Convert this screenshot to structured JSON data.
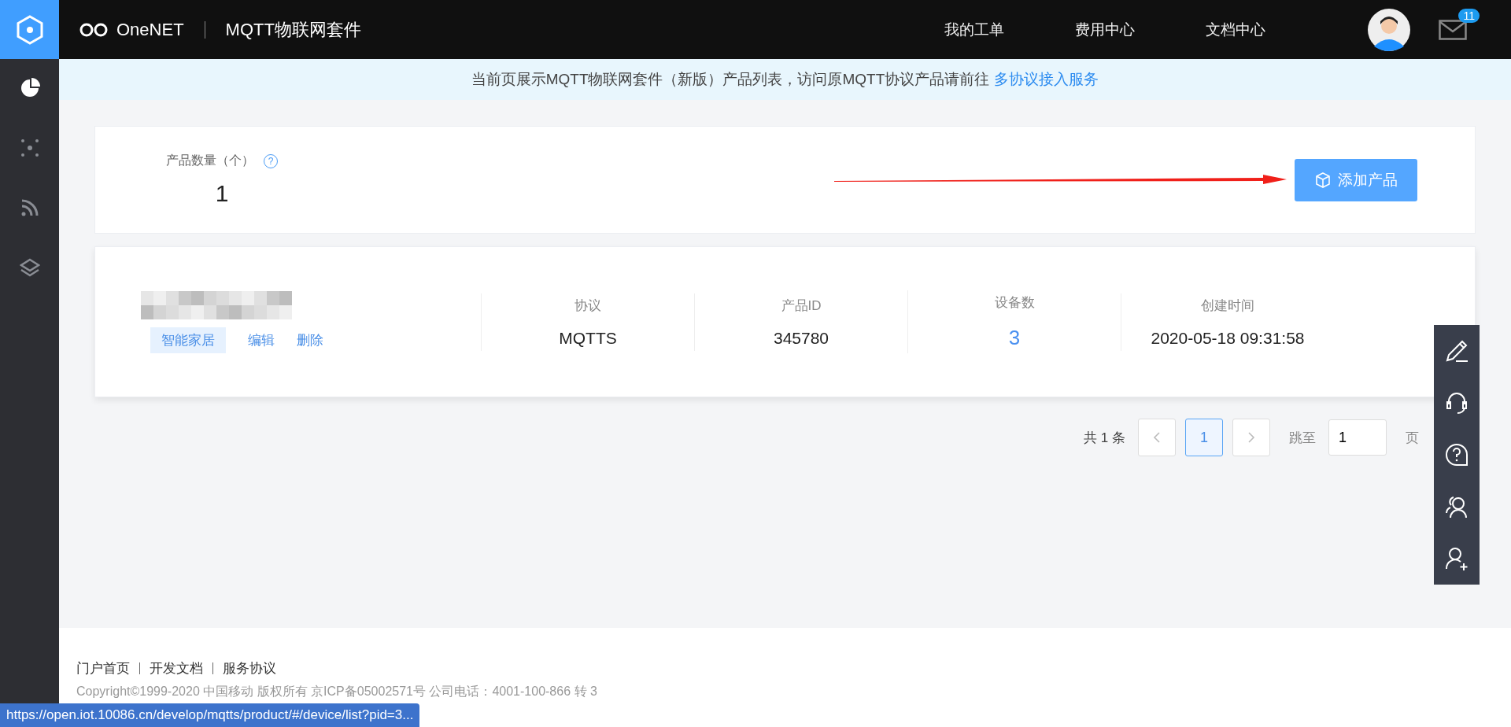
{
  "header": {
    "brand": "OneNET",
    "product": "MQTT物联网套件",
    "nav": [
      "我的工单",
      "费用中心",
      "文档中心"
    ],
    "badge": "11"
  },
  "sidebar": {
    "items": [
      {
        "selected": true
      },
      {
        "selected": false
      },
      {
        "selected": false
      },
      {
        "selected": false
      }
    ]
  },
  "notice": {
    "text": "当前页展示MQTT物联网套件（新版）产品列表，访问原MQTT协议产品请前往",
    "link": "多协议接入服务"
  },
  "summary": {
    "label": "产品数量（个）",
    "help": "?",
    "count": "1",
    "add_button": "添加产品"
  },
  "products": [
    {
      "tag": "智能家居",
      "actions": [
        "编辑",
        "删除"
      ],
      "fields": [
        {
          "label": "协议",
          "value": "MQTTS",
          "kind": "text"
        },
        {
          "label": "产品ID",
          "value": "345780",
          "kind": "text"
        },
        {
          "label": "设备数",
          "value": "3",
          "kind": "link"
        },
        {
          "label": "创建时间",
          "value": "2020-05-18 09:31:58",
          "kind": "text"
        }
      ]
    }
  ],
  "pagination": {
    "total": "共 1 条",
    "pages": [
      {
        "label": "1",
        "selected": true
      }
    ],
    "jump_label": "跳至",
    "jump_value": "1",
    "page_suffix": "页"
  },
  "footer": {
    "links": [
      "门户首页",
      "开发文档",
      "服务协议"
    ],
    "copyright": "Copyright©1999-2020 中国移动 版权所有 京ICP备05002571号 公司电话：4001-100-866 转 3"
  },
  "status_url": "https://open.iot.10086.cn/develop/mqtts/product/#/device/list?pid=3..."
}
